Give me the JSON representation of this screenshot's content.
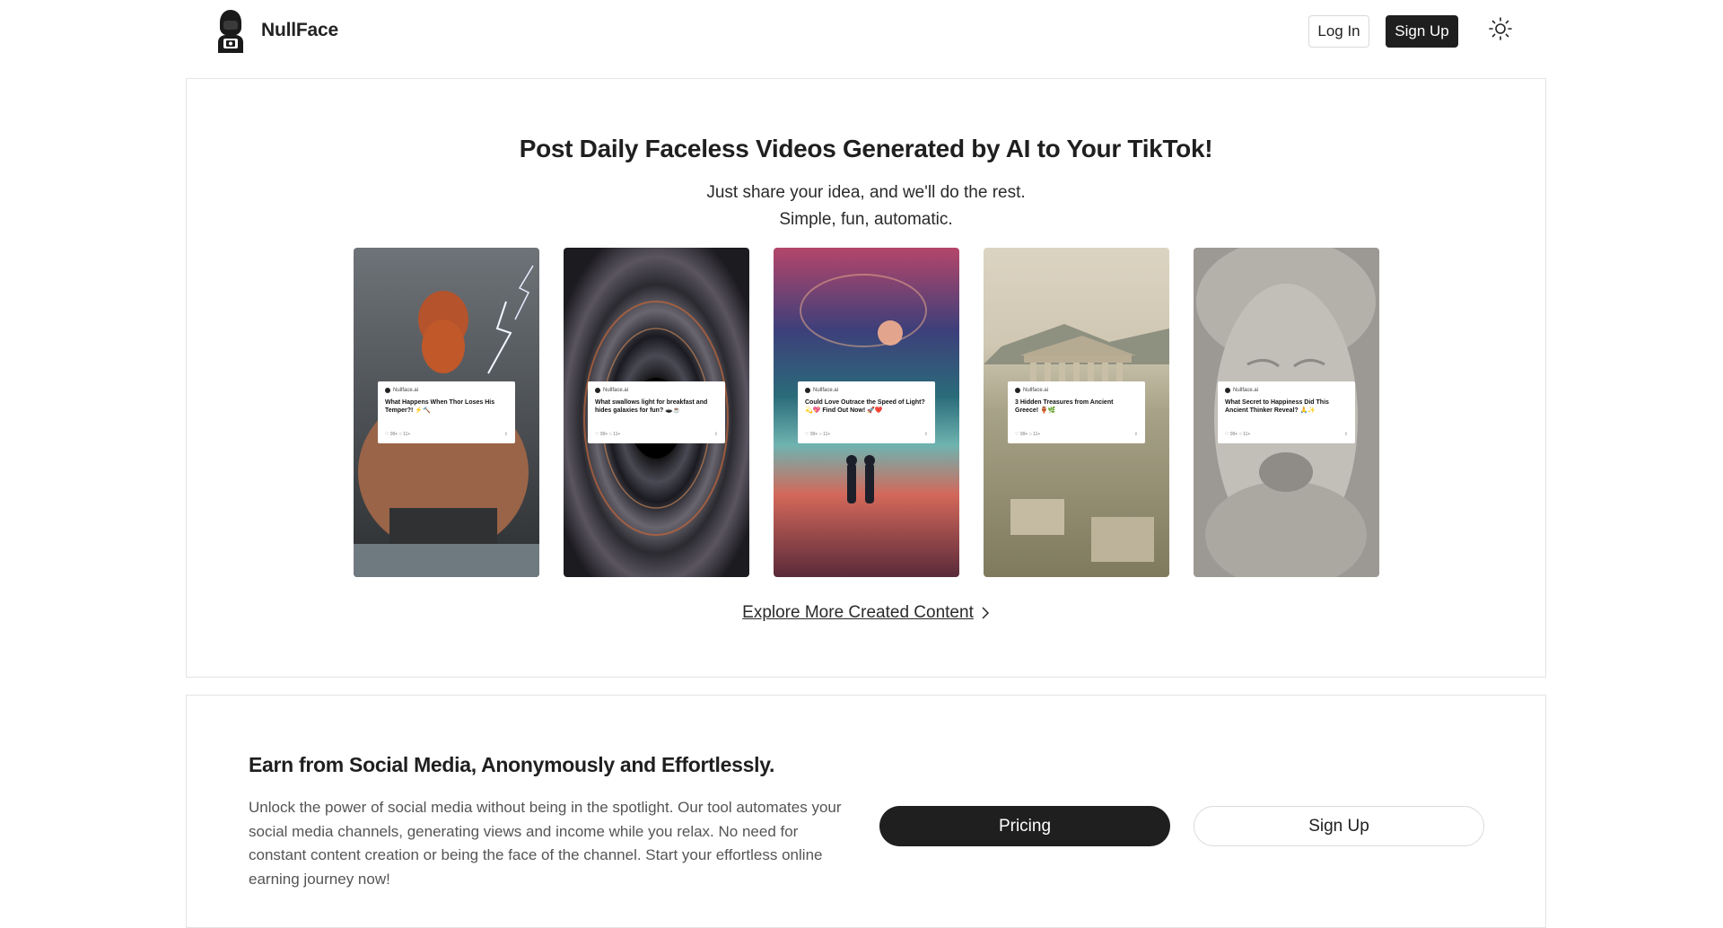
{
  "brand": {
    "name": "NullFace"
  },
  "nav": {
    "login_label": "Log In",
    "signup_label": "Sign Up",
    "theme_icon": "sun-icon"
  },
  "hero": {
    "title": "Post Daily Faceless Videos Generated by AI to Your TikTok!",
    "subtitle_line1": "Just share your idea, and we'll do the rest.",
    "subtitle_line2": "Simple, fun, automatic.",
    "explore_label": "Explore More Created Content"
  },
  "videos": [
    {
      "source": "Nullface.ai",
      "caption": "What Happens When Thor Loses His Temper?! ⚡🔨",
      "likes": "99+",
      "comments": "11+",
      "scene": "thor"
    },
    {
      "source": "Nullface.ai",
      "caption": "What swallows light for breakfast and hides galaxies for fun? 🕳️☕",
      "likes": "99+",
      "comments": "11+",
      "scene": "blackhole"
    },
    {
      "source": "Nullface.ai",
      "caption": "Could Love Outrace the Speed of Light? 💫💖 Find Out Now! 🚀❤️",
      "likes": "99+",
      "comments": "11+",
      "scene": "cosmos"
    },
    {
      "source": "Nullface.ai",
      "caption": "3 Hidden Treasures from Ancient Greece! 🏺🌿",
      "likes": "99+",
      "comments": "11+",
      "scene": "greece"
    },
    {
      "source": "Nullface.ai",
      "caption": "What Secret to Happiness Did This Ancient Thinker Reveal? 🙏✨",
      "likes": "99+",
      "comments": "11+",
      "scene": "statue"
    }
  ],
  "earn": {
    "title": "Earn from Social Media, Anonymously and Effortlessly.",
    "body": "Unlock the power of social media without being in the spotlight. Our tool automates your social media channels, generating views and income while you relax. No need for constant content creation or being the face of the channel. Start your effortless online earning journey now!",
    "pricing_label": "Pricing",
    "signup_label": "Sign Up"
  }
}
